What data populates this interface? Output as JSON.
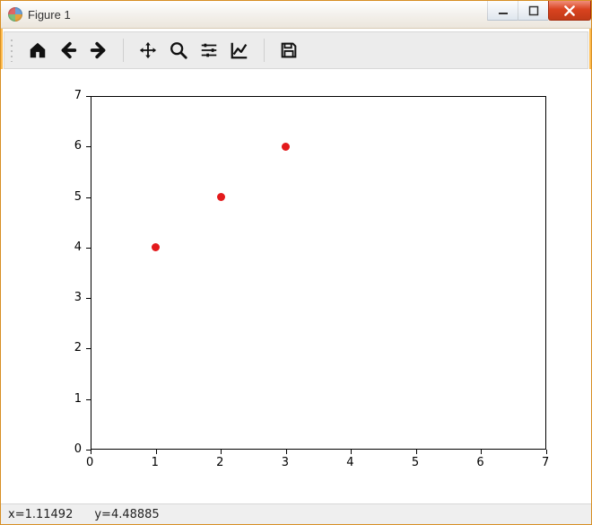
{
  "window": {
    "title": "Figure 1"
  },
  "toolbar": {
    "home": "Home",
    "back": "Back",
    "forward": "Forward",
    "pan": "Pan",
    "zoom": "Zoom",
    "subplots": "Configure subplots",
    "edit": "Edit axis",
    "save": "Save"
  },
  "status": {
    "x_label": "x=1.11492",
    "y_label": "y=4.48885"
  },
  "chart_data": {
    "type": "scatter",
    "x": [
      1,
      2,
      3
    ],
    "y": [
      4,
      5,
      6
    ],
    "xlim": [
      0,
      7
    ],
    "ylim": [
      0,
      7
    ],
    "xticks": [
      0,
      1,
      2,
      3,
      4,
      5,
      6,
      7
    ],
    "yticks": [
      0,
      1,
      2,
      3,
      4,
      5,
      6,
      7
    ],
    "marker_color": "#e31a1c",
    "title": "",
    "xlabel": "",
    "ylabel": ""
  }
}
